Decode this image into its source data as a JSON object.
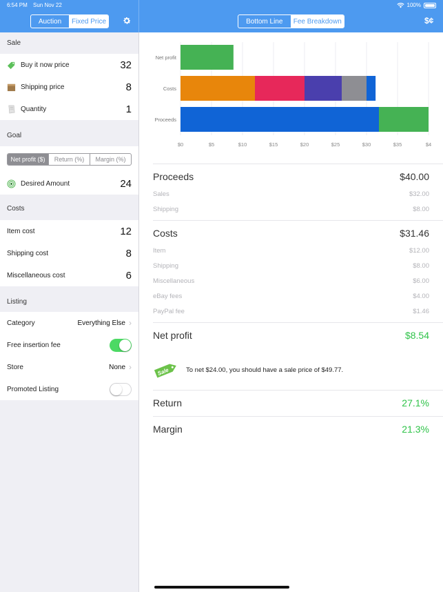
{
  "status": {
    "time": "6:54 PM",
    "date": "Sun Nov 22",
    "battery": "100%"
  },
  "nav": {
    "left_tabs": [
      "Auction",
      "Fixed Price"
    ],
    "left_selected": 1,
    "right_tabs": [
      "Bottom Line",
      "Fee Breakdown"
    ],
    "right_selected": 0,
    "currency_icon": "$¢"
  },
  "sale": {
    "header": "Sale",
    "rows": [
      {
        "label": "Buy it now price",
        "value": "32",
        "icon": "tag-icon"
      },
      {
        "label": "Shipping price",
        "value": "8",
        "icon": "box-icon"
      },
      {
        "label": "Quantity",
        "value": "1",
        "icon": "note-icon"
      }
    ]
  },
  "goal": {
    "header": "Goal",
    "tabs": [
      "Net profit ($)",
      "Return (%)",
      "Margin (%)"
    ],
    "selected": 0,
    "desired_label": "Desired Amount",
    "desired_value": "24"
  },
  "costs": {
    "header": "Costs",
    "rows": [
      {
        "label": "Item cost",
        "value": "12"
      },
      {
        "label": "Shipping cost",
        "value": "8"
      },
      {
        "label": "Miscellaneous cost",
        "value": "6"
      }
    ]
  },
  "listing": {
    "header": "Listing",
    "category_label": "Category",
    "category_value": "Everything Else",
    "free_insertion_label": "Free insertion fee",
    "free_insertion_on": true,
    "store_label": "Store",
    "store_value": "None",
    "promoted_label": "Promoted Listing",
    "promoted_on": false
  },
  "chart_data": {
    "type": "bar",
    "orientation": "horizontal",
    "stacked": true,
    "categories": [
      "Net profit",
      "Costs",
      "Proceeds"
    ],
    "x_ticks": [
      "$0",
      "$5",
      "$10",
      "$15",
      "$20",
      "$25",
      "$30",
      "$35",
      "$4"
    ],
    "xlim": [
      0,
      40
    ],
    "grid": true,
    "series": [
      {
        "color": "#45b254",
        "values": [
          8.54,
          0,
          0
        ]
      },
      {
        "color": "#e8860b",
        "values": [
          0,
          12,
          0
        ]
      },
      {
        "color": "#e7285a",
        "values": [
          0,
          8,
          0
        ]
      },
      {
        "color": "#4a3fad",
        "values": [
          0,
          6,
          0
        ]
      },
      {
        "color": "#8e8e93",
        "values": [
          0,
          4,
          0
        ]
      },
      {
        "color": "#1064d6",
        "values": [
          0,
          1.46,
          32
        ]
      },
      {
        "color": "#45b254",
        "values": [
          0,
          0,
          8
        ]
      }
    ]
  },
  "summary": {
    "proceeds": {
      "label": "Proceeds",
      "value": "$40.00"
    },
    "proceeds_items": [
      {
        "label": "Sales",
        "value": "$32.00"
      },
      {
        "label": "Shipping",
        "value": "$8.00"
      }
    ],
    "costs": {
      "label": "Costs",
      "value": "$31.46"
    },
    "costs_items": [
      {
        "label": "Item",
        "value": "$12.00"
      },
      {
        "label": "Shipping",
        "value": "$8.00"
      },
      {
        "label": "Miscellaneous",
        "value": "$6.00"
      },
      {
        "label": "eBay fees",
        "value": "$4.00"
      },
      {
        "label": "PayPal fee",
        "value": "$1.46"
      }
    ],
    "net_profit": {
      "label": "Net profit",
      "value": "$8.54"
    },
    "tip_badge": "Sale",
    "tip": "To net $24.00, you should have a sale price of $49.77.",
    "return": {
      "label": "Return",
      "value": "27.1%"
    },
    "margin": {
      "label": "Margin",
      "value": "21.3%"
    }
  },
  "colors": {
    "accent": "#4d9af0",
    "positive": "#2fc349",
    "toggle_on": "#4cd964"
  }
}
